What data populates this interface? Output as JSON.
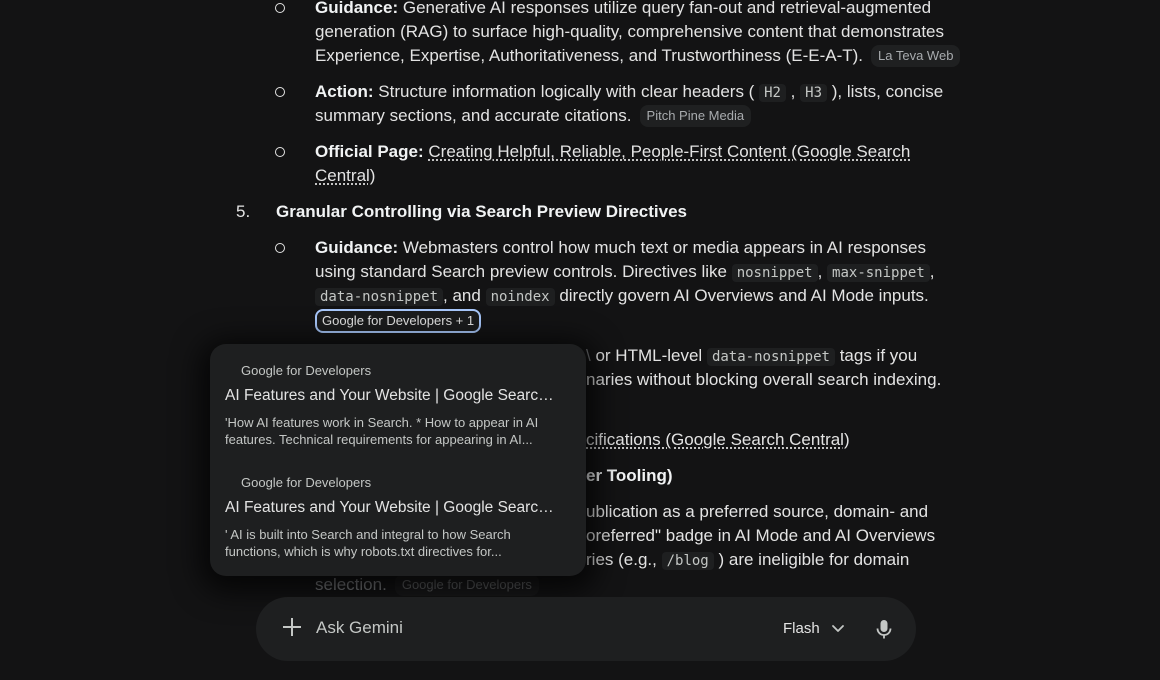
{
  "list": {
    "item_a": {
      "label": "Guidance:",
      "line1": "Generative AI responses utilize query fan-out and retrieval-augmented",
      "line2": "generation (RAG) to surface high-quality, comprehensive content that demonstrates",
      "line3": "Experience, Expertise, Authoritativeness, and Trustworthiness (E-E-A-T).",
      "chip": "La Teva Web"
    },
    "item_b": {
      "label": "Action:",
      "line1_pre": "Structure information logically with clear headers (",
      "code1": "H2",
      "comma": ",",
      "code2": "H3",
      "line1_post": "), lists, concise",
      "line2": "summary sections, and accurate citations.",
      "chip": "Pitch Pine Media"
    },
    "item_c": {
      "label": "Official Page:",
      "link1": "Creating Helpful, Reliable, People-First Content (Google Search",
      "link2": "Central)"
    },
    "section5": {
      "number": "5.",
      "title": "Granular Controlling via Search Preview Directives",
      "guidance": {
        "label": "Guidance:",
        "line1": "Webmasters control how much text or media appears in AI responses",
        "line2_pre": "using standard Search preview controls. Directives like",
        "code_nosnippet": "nosnippet",
        "sep": ",",
        "code_maxsnippet": "max-snippet",
        "code_datanosnippet": "data-nosnippet",
        "and": ", and",
        "code_noindex": "noindex",
        "line3_post": "directly govern AI Overviews and AI Mode inputs.",
        "chip": "Google for Developers + 1"
      },
      "hidden_fragments": {
        "tick": "\\",
        "frag1_pre": "or HTML-level",
        "frag1_code": "data-nosnippet",
        "frag1_post": "tags if you",
        "frag2": "naries without blocking overall search indexing.",
        "frag3_link": "cifications (Google Search Central)",
        "frag4": "er Tooling)",
        "frag5": "ublication as a preferred source, domain- and",
        "frag6": "oreferred\" badge in AI Mode and AI Overviews",
        "frag7_pre": "ries (e.g.,",
        "frag7_code": "/blog",
        "frag7_post": ") are ineligible for domain",
        "frag8": "selection.",
        "frag8_chip": "Google for Developers"
      }
    }
  },
  "popup": {
    "cards": [
      {
        "source": "Google for Developers",
        "title": "AI Features and Your Website | Google Search...",
        "snippet1": "'How AI features work in Search. * How to appear in AI",
        "snippet2": "features. Technical requirements for appearing in AI..."
      },
      {
        "source": "Google for Developers",
        "title": "AI Features and Your Website | Google Search...",
        "snippet1": "' AI is built into Search and integral to how Search",
        "snippet2": "functions, which is why robots.txt directives for..."
      }
    ]
  },
  "input": {
    "placeholder": "Ask Gemini",
    "model": "Flash",
    "icons": [
      "plus-icon",
      "chevron-down-icon",
      "microphone-icon"
    ]
  }
}
